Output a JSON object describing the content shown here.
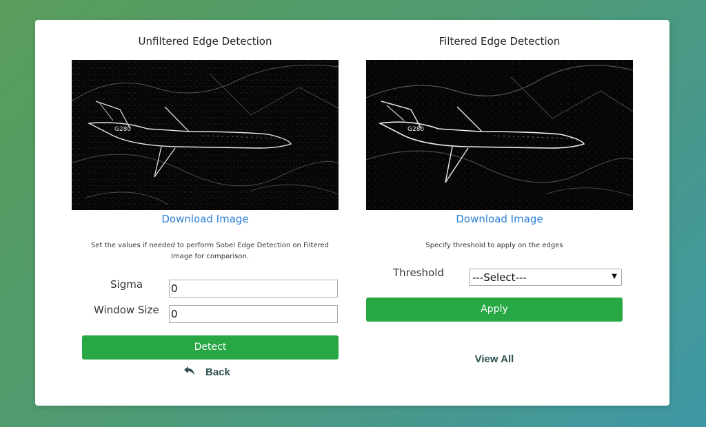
{
  "left_panel": {
    "title": "Unfiltered Edge Detection",
    "download_label": "Download Image",
    "help_text": "Set the values if needed to perform Sobel Edge Detection on Filtered Image for comparison.",
    "sigma_label": "Sigma",
    "sigma_value": "0",
    "window_size_label": "Window Size",
    "window_size_value": "0",
    "detect_label": "Detect",
    "back_label": "Back",
    "back_icon": "reply-arrow-icon"
  },
  "right_panel": {
    "title": "Filtered Edge Detection",
    "download_label": "Download Image",
    "help_text": "Specify threshold to apply on the edges",
    "threshold_label": "Threshold",
    "threshold_selected": "---Select---",
    "apply_label": "Apply",
    "view_all_label": "View All"
  },
  "images": {
    "unfiltered_text": "G280",
    "filtered_text": "G280"
  },
  "colors": {
    "accent_green": "#28a745",
    "link_blue": "#2a7fd4",
    "dark_text": "#2f4f4f"
  }
}
